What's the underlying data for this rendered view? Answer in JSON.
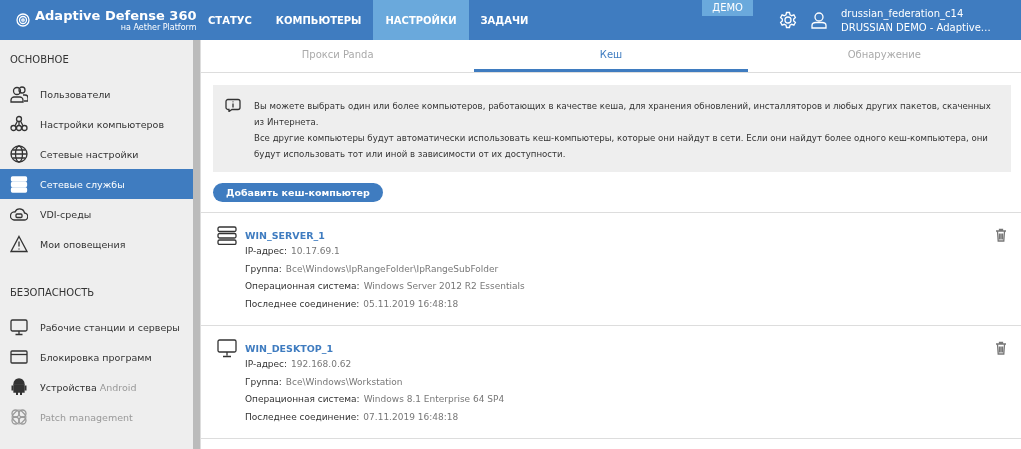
{
  "header": {
    "logo_title": "Adaptive Defense 360",
    "logo_subtitle": "на Aether Platform",
    "nav": [
      {
        "label": "СТАТУС",
        "selected": false
      },
      {
        "label": "КОМПЬЮТЕРЫ",
        "selected": false
      },
      {
        "label": "НАСТРОЙКИ",
        "selected": true
      },
      {
        "label": "ЗАДАЧИ",
        "selected": false
      }
    ],
    "badge": "ДЕМО",
    "user_name": "drussian_federation_c14",
    "user_account": "DRUSSIAN DEMO - Adaptive…"
  },
  "sidebar": {
    "sections": [
      {
        "title": "ОСНОВНОЕ",
        "items": [
          {
            "label": "Пользователи",
            "selected": false,
            "disabled": false
          },
          {
            "label": "Настройки компьютеров",
            "selected": false,
            "disabled": false
          },
          {
            "label": "Сетевые настройки",
            "selected": false,
            "disabled": false
          },
          {
            "label": "Сетевые службы",
            "selected": true,
            "disabled": false
          },
          {
            "label": "VDI-среды",
            "selected": false,
            "disabled": false
          },
          {
            "label": "Мои оповещения",
            "selected": false,
            "disabled": false
          }
        ]
      },
      {
        "title": "БЕЗОПАСНОСТЬ",
        "items": [
          {
            "label": "Рабочие станции и серверы",
            "selected": false,
            "disabled": false
          },
          {
            "label": "Блокировка программ",
            "selected": false,
            "disabled": false
          },
          {
            "label": "Устройства",
            "suffix": "Android",
            "selected": false,
            "disabled": false
          },
          {
            "label": "Patch management",
            "selected": false,
            "disabled": true
          }
        ]
      }
    ]
  },
  "tabs": [
    {
      "label": "Прокси Panda",
      "selected": false
    },
    {
      "label": "Кеш",
      "selected": true
    },
    {
      "label": "Обнаружение",
      "selected": false
    }
  ],
  "info": [
    "Вы можете выбрать один или более компьютеров, работающих в качестве кеша, для хранения обновлений, инсталляторов и любых других пакетов, скаченных из Интернета.",
    "Все другие компьютеры будут автоматически использовать кеш-компьютеры, которые они найдут в сети. Если они найдут более одного кеш-компьютера, они будут использовать тот или иной в зависимости от их доступности."
  ],
  "add_button": "Добавить кеш-компьютер",
  "computers": [
    {
      "kind": "server",
      "name": "WIN_SERVER_1",
      "fields": [
        {
          "label": "IP-адрес:",
          "value": "10.17.69.1"
        },
        {
          "label": "Группа:",
          "value": "Все\\Windows\\IpRangeFolder\\IpRangeSubFolder"
        },
        {
          "label": "Операционная система:",
          "value": "Windows Server 2012 R2 Essentials"
        },
        {
          "label": "Последнее соединение:",
          "value": "05.11.2019 16:48:18"
        }
      ]
    },
    {
      "kind": "desktop",
      "name": "WIN_DESKTOP_1",
      "fields": [
        {
          "label": "IP-адрес:",
          "value": "192.168.0.62"
        },
        {
          "label": "Группа:",
          "value": "Все\\Windows\\Workstation"
        },
        {
          "label": "Операционная система:",
          "value": "Windows 8.1 Enterprise 64 SP4"
        },
        {
          "label": "Последнее соединение:",
          "value": "07.11.2019 16:48:18"
        }
      ]
    }
  ]
}
